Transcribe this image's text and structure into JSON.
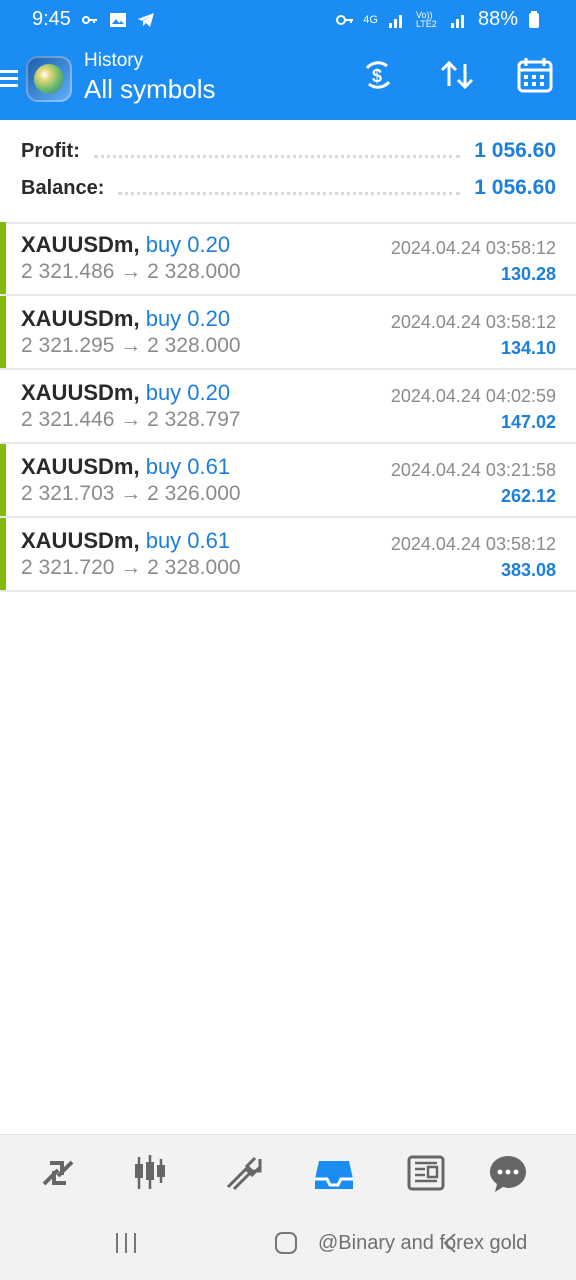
{
  "status_bar": {
    "time": "9:45",
    "network_label": "4G",
    "volte_label": "Vo)) LTE2",
    "battery": "88%"
  },
  "header": {
    "section": "History",
    "title": "All symbols"
  },
  "summary": {
    "profit_label": "Profit:",
    "profit_value": "1 056.60",
    "balance_label": "Balance:",
    "balance_value": "1 056.60"
  },
  "trades": [
    {
      "symbol": "XAUUSDm,",
      "side": "buy 0.20",
      "open": "2 321.486",
      "arrow": "→",
      "close": "2 328.000",
      "time": "2024.04.24 03:58:12",
      "profit": "130.28",
      "bar_visible": true
    },
    {
      "symbol": "XAUUSDm,",
      "side": "buy 0.20",
      "open": "2 321.295",
      "arrow": "→",
      "close": "2 328.000",
      "time": "2024.04.24 03:58:12",
      "profit": "134.10",
      "bar_visible": true
    },
    {
      "symbol": "XAUUSDm,",
      "side": "buy 0.20",
      "open": "2 321.446",
      "arrow": "→",
      "close": "2 328.797",
      "time": "2024.04.24 04:02:59",
      "profit": "147.02",
      "bar_visible": false
    },
    {
      "symbol": "XAUUSDm,",
      "side": "buy 0.61",
      "open": "2 321.703",
      "arrow": "→",
      "close": "2 326.000",
      "time": "2024.04.24 03:21:58",
      "profit": "262.12",
      "bar_visible": true
    },
    {
      "symbol": "XAUUSDm,",
      "side": "buy 0.61",
      "open": "2 321.720",
      "arrow": "→",
      "close": "2 328.000",
      "time": "2024.04.24 03:58:12",
      "profit": "383.08",
      "bar_visible": true
    }
  ],
  "bottom_nav": {
    "items": [
      {
        "icon": "quotes-icon"
      },
      {
        "icon": "chart-icon"
      },
      {
        "icon": "trade-icon"
      },
      {
        "icon": "history-icon",
        "active": true
      },
      {
        "icon": "news-icon"
      },
      {
        "icon": "chat-icon"
      }
    ]
  },
  "watermark": "@Binary and forex gold",
  "colors": {
    "primary": "#1b8cf4",
    "accent_blue": "#1b7fdb",
    "profit_bar_green": "#86b90d",
    "text_gray": "#8b8b8b"
  }
}
